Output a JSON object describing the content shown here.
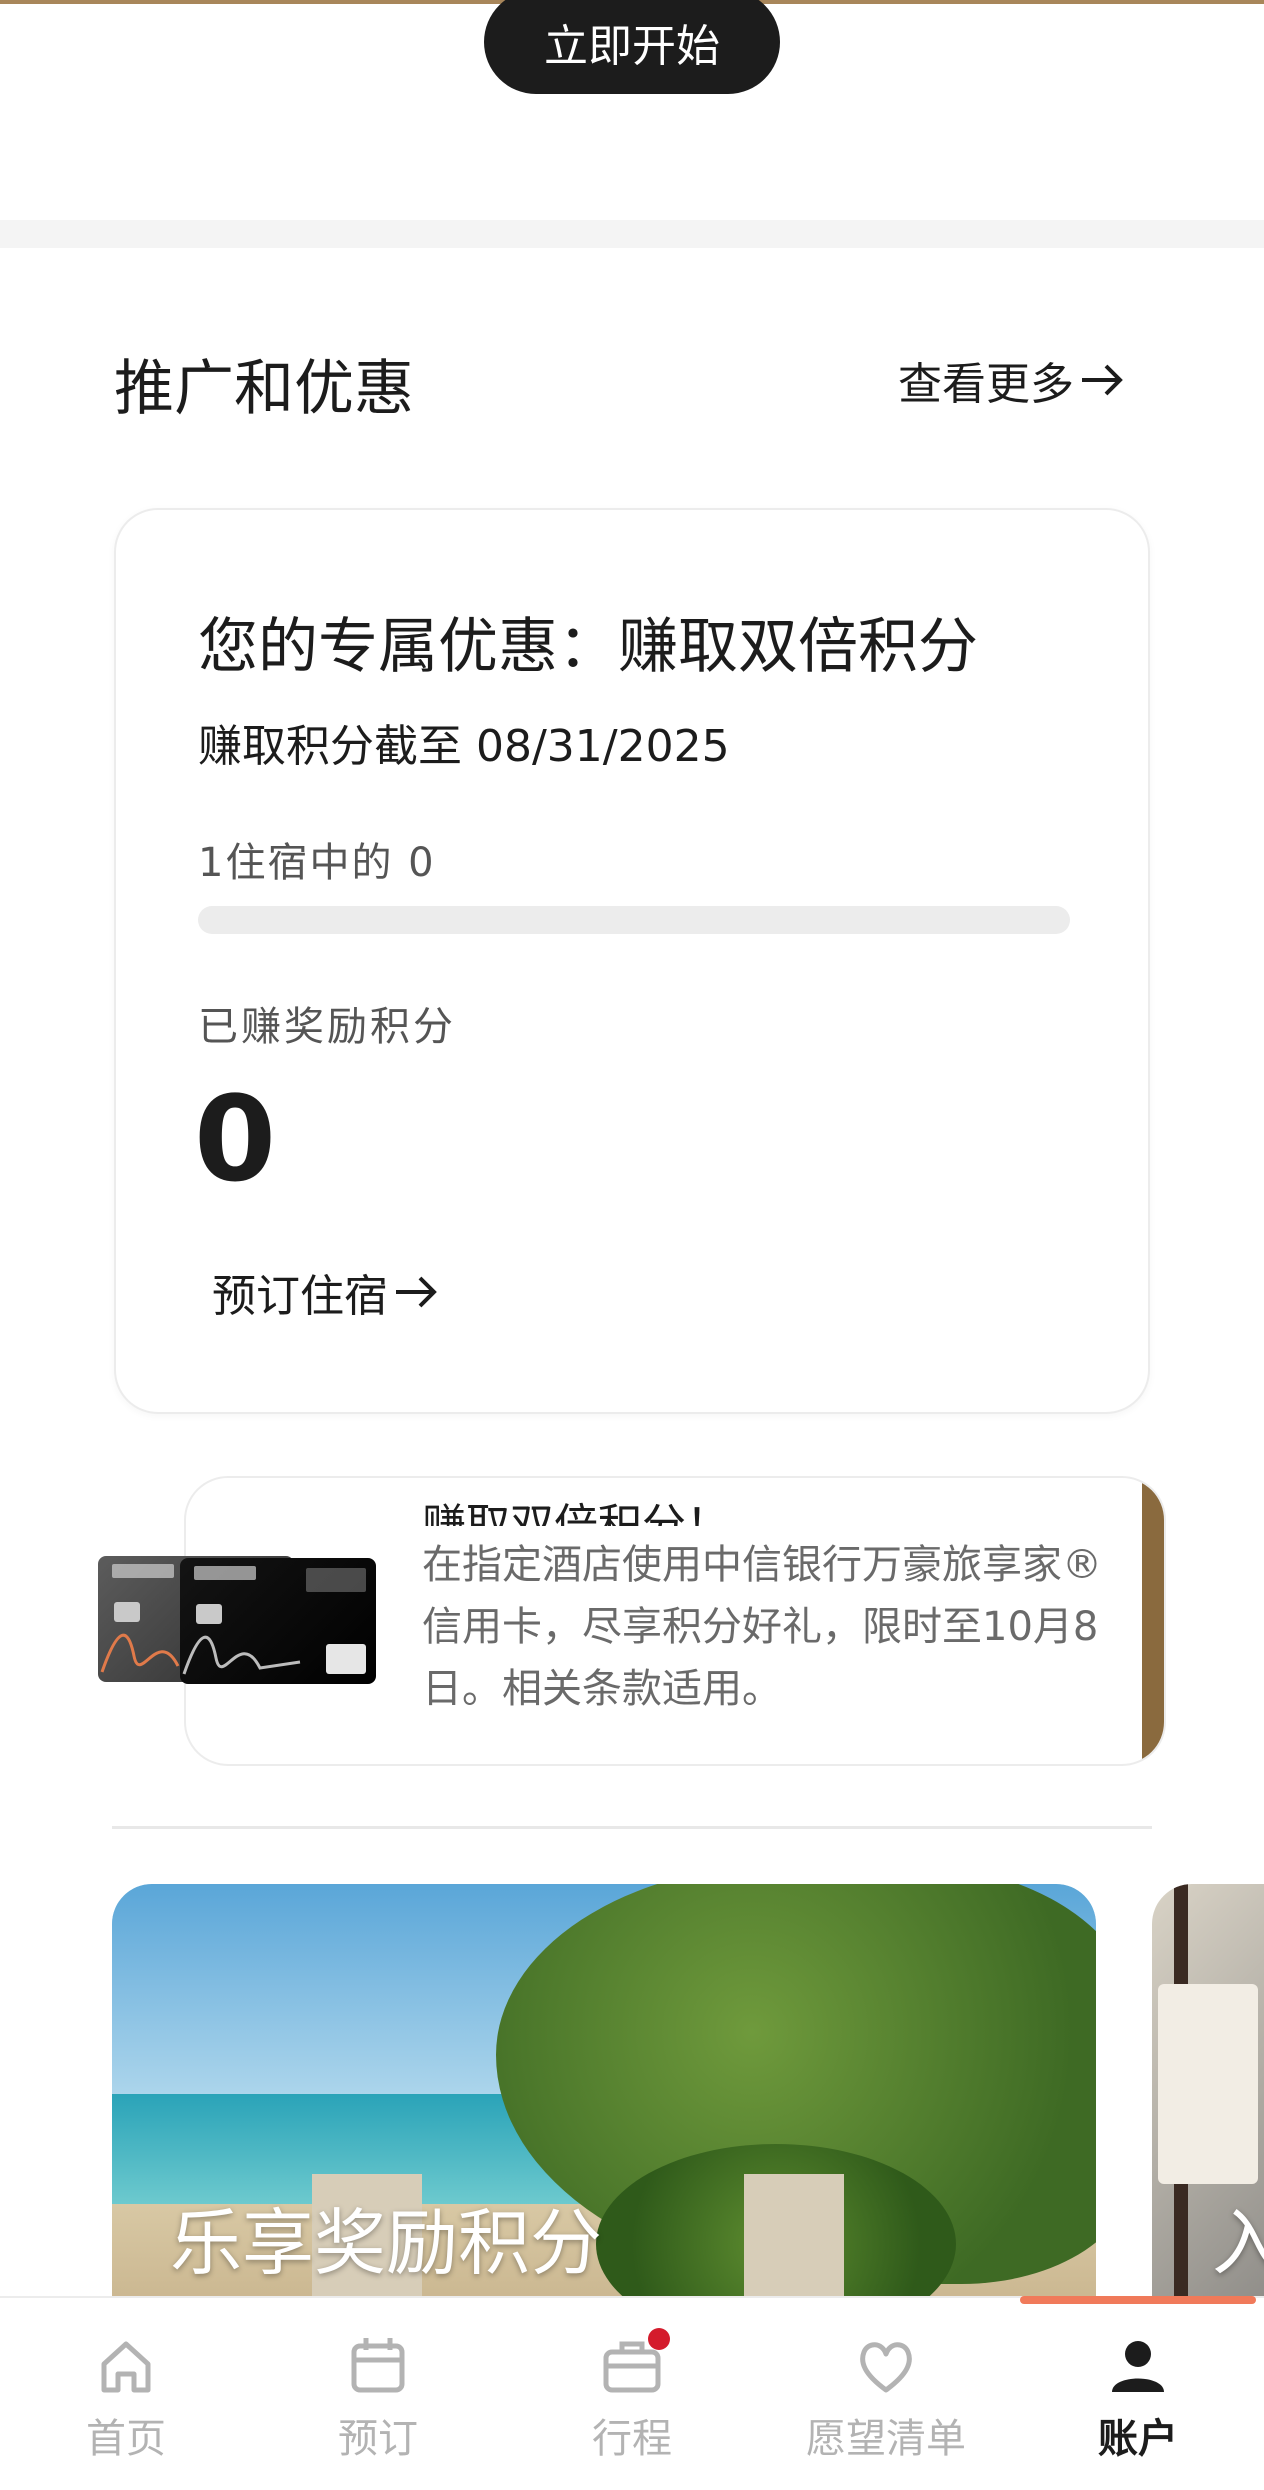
{
  "top": {
    "start_button": "立即开始"
  },
  "section": {
    "title": "推广和优惠",
    "see_more": "查看更多"
  },
  "offer": {
    "title": "您的专属优惠：赚取双倍积分",
    "subtitle": "赚取积分截至 08/31/2025",
    "stay_progress_label": "1住宿中的 0",
    "stay_progress": 0,
    "earned_label": "已赚奖励积分",
    "earned_value": "0",
    "book_link": "预订住宿"
  },
  "promo": {
    "title_partial": "赚取双倍积分！",
    "body": "在指定酒店使用中信银行万豪旅享家®信用卡，尽享积分好礼，限时至10月8日。相关条款适用。",
    "accent_color": "#8a6a3e"
  },
  "features": [
    {
      "title": "乐享奖励积分"
    },
    {
      "title": "入"
    }
  ],
  "tabbar": {
    "items": [
      {
        "label": "首页",
        "icon": "home-icon"
      },
      {
        "label": "预订",
        "icon": "calendar-icon"
      },
      {
        "label": "行程",
        "icon": "suitcase-icon"
      },
      {
        "label": "愿望清单",
        "icon": "heart-icon"
      },
      {
        "label": "账户",
        "icon": "person-icon"
      }
    ],
    "active_index": 4
  },
  "colors": {
    "accent_gold": "#a8865a",
    "dark": "#1c1c1c",
    "badge_red": "#d41b2c"
  }
}
